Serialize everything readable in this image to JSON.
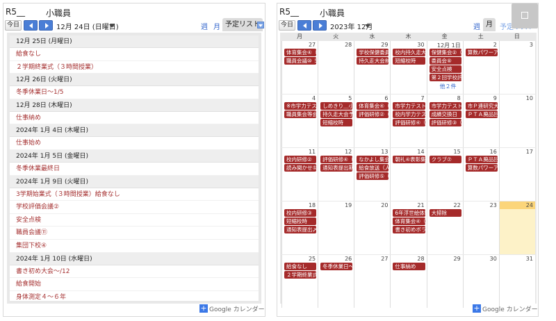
{
  "left": {
    "title_left": "R5__",
    "title_right": "小職員",
    "today_label": "今日",
    "date_label": "12月 24日 (日曜日)",
    "week_label": "週",
    "month_label": "月",
    "agenda_label": "予定リスト",
    "agenda": [
      {
        "date": "12月 25日 (月曜日)",
        "events": [
          "給食なし",
          "２学期終業式（３時間授業）"
        ]
      },
      {
        "date": "12月 26日 (火曜日)",
        "events": [
          "冬季休業日～1/5"
        ]
      },
      {
        "date": "12月 28日 (木曜日)",
        "events": [
          "仕事納め"
        ]
      },
      {
        "date": "2024年 1月 4日 (木曜日)",
        "events": [
          "仕事始め"
        ]
      },
      {
        "date": "2024年 1月 5日 (金曜日)",
        "events": [
          "冬季休業最終日"
        ]
      },
      {
        "date": "2024年 1月 9日 (火曜日)",
        "events": [
          "3学期始業式（３時間授業）給食なし",
          "学校評価会議②",
          "安全点検",
          "職員会議⑪",
          "集団下校④"
        ]
      },
      {
        "date": "2024年 1月 10日 (水曜日)",
        "events": [
          "書き初め大会～/12",
          "給食開始",
          "身体測定４～６年"
        ]
      }
    ],
    "footer_plus": "+",
    "footer_text": "Google カレンダー"
  },
  "right": {
    "title_left": "R5__",
    "title_right": "小職員",
    "today_label": "今日",
    "date_label": "2023年 12月",
    "week_label": "週",
    "month_label": "月",
    "agenda_label": "予定リスト",
    "dow": [
      "月",
      "火",
      "水",
      "木",
      "金",
      "土",
      "日"
    ],
    "weeks": [
      {
        "days": [
          "27",
          "28",
          "29",
          "30",
          "12月 1日",
          "2",
          "3"
        ]
      },
      {
        "days": [
          "4",
          "5",
          "6",
          "7",
          "8",
          "9",
          "10"
        ]
      },
      {
        "days": [
          "11",
          "12",
          "13",
          "14",
          "15",
          "16",
          "17"
        ]
      },
      {
        "days": [
          "18",
          "19",
          "20",
          "21",
          "22",
          "23",
          "24"
        ]
      },
      {
        "days": [
          "25",
          "26",
          "27",
          "28",
          "29",
          "30",
          "31"
        ]
      }
    ],
    "events": {
      "w0": [
        [
          "体育集会④（Ⅰ",
          "職員会議⑩ ５"
        ],
        [],
        [
          "学校保健委員会",
          "持久走大会前日"
        ],
        [
          "校内持久走大会",
          "短縮校時"
        ],
        [
          "保健集会②（Ⅰ",
          "委員会⑧",
          "安全点検",
          "第２回学校評価"
        ],
        [
          "算数パワーアップ"
        ],
        []
      ],
      "w0_more": "他２件",
      "w1": [
        [
          "※市学力テスト！",
          "職員集会等会"
        ],
        [
          "しめきり＿小",
          "持久走大会予備",
          "短縮校時"
        ],
        [
          "体育集会④（Ⅰ",
          "評価研修②（Ⅰ"
        ],
        [
          "市学力テスト！",
          "校内学力テスト",
          "評価研修④（Ⅰ"
        ],
        [
          "市学力テスト！",
          "成績交換日",
          "評価研修③（Ⅰ"
        ],
        [
          "市Ｐ連研究大会",
          "ＰＴＡ廃品回収"
        ],
        []
      ],
      "w2": [
        [
          "校内研修②",
          "読み聞かせ⑤"
        ],
        [
          "評価研修④（Ⅰ",
          "通知表提出期限"
        ],
        [
          "なかよし集会⑥",
          "給食放送（人権",
          "評価研修⑤（Ⅰ"
        ],
        [
          "朝礼④表彰集会"
        ],
        [
          "クラブ⑦"
        ],
        [
          "ＰＴＡ廃品回収",
          "算数パワーアップ"
        ],
        []
      ],
      "w3": [
        [
          "校内研修③",
          "短縮校時",
          "通知表提出〆切"
        ],
        [],
        [],
        [
          "6年浮世絵体験",
          "体育集会④（Ⅰ",
          "書き初めボランティア"
        ],
        [
          "大掃除"
        ],
        [],
        []
      ],
      "w4": [
        [
          "給食なし",
          "２学期終業式"
        ],
        [
          "冬季休業日～1"
        ],
        [],
        [
          "仕事納め"
        ],
        [],
        [],
        []
      ]
    },
    "footer_plus": "+",
    "footer_text": "Google カレンダー"
  },
  "colors": {
    "event_bg": "#a52a2a",
    "event_text_agenda": "#a53030",
    "link": "#3366cc",
    "today_bg": "#fdf2c8",
    "today_header": "#fbd57a",
    "nav_blue": "#4a7ed6"
  }
}
